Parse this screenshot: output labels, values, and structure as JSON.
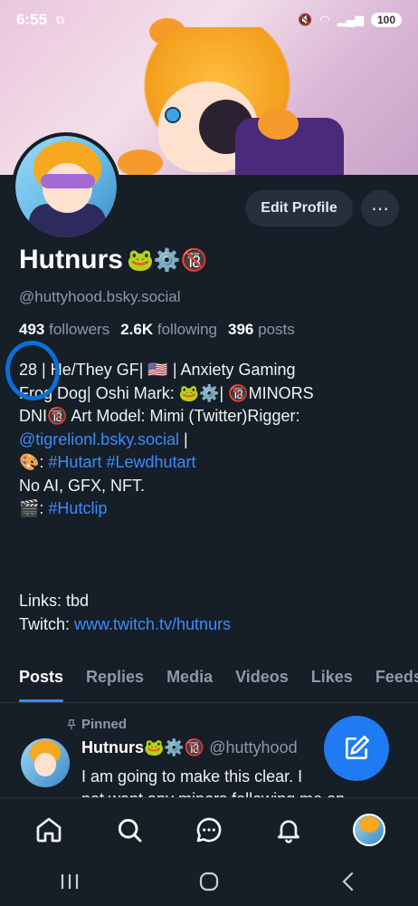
{
  "status": {
    "time": "6:55",
    "battery": "100"
  },
  "profile": {
    "display_name": "Hutnurs",
    "name_emojis": "🐸⚙️🔞",
    "handle": "@huttyhood.bsky.social",
    "followers_count": "493",
    "followers_label": "followers",
    "following_count": "2.6K",
    "following_label": "following",
    "posts_count": "396",
    "posts_label": "posts",
    "edit_label": "Edit Profile",
    "more_label": "⋯"
  },
  "bio": {
    "line1": "28 | He/They GF| 🇺🇸 | Anxiety Gaming",
    "line2": "Frog Dog| Oshi Mark: 🐸⚙️| 🔞MINORS",
    "line3": "DNI🔞 Art Model: Mimi (Twitter)Rigger:",
    "mention": "@tigrelionl.bsky.social",
    "line4_suffix": " |",
    "line5_prefix": "🎨: ",
    "tag1": "#Hutart",
    "tag2": "#Lewdhutart",
    "line6": "No AI, GFX, NFT.",
    "line7_prefix": "🎬: ",
    "tag3": "#Hutclip",
    "links_line": "Links: tbd",
    "twitch_prefix": "Twitch: ",
    "twitch_url": "www.twitch.tv/hutnurs"
  },
  "tabs": [
    {
      "label": "Posts"
    },
    {
      "label": "Replies"
    },
    {
      "label": "Media"
    },
    {
      "label": "Videos"
    },
    {
      "label": "Likes"
    },
    {
      "label": "Feeds"
    }
  ],
  "post": {
    "pinned_label": "Pinned",
    "author": "Hutnurs🐸⚙️🔞",
    "handle": "@huttyhood",
    "handle_tail": "o",
    "text1": "I am going to make this clear. I",
    "text2": "not want any minors following me on"
  }
}
